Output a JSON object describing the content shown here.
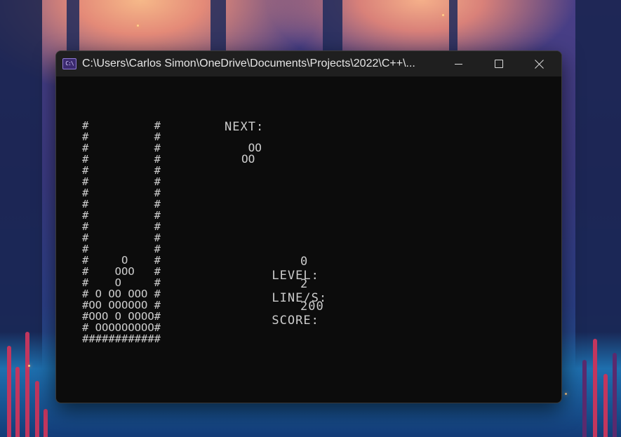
{
  "window": {
    "title": "C:\\Users\\Carlos Simon\\OneDrive\\Documents\\Projects\\2022\\C++\\...",
    "icon": "console-app-icon",
    "icon_text": "C:\\"
  },
  "controls": {
    "minimize": "minimize-icon",
    "maximize": "maximize-icon",
    "close": "close-icon"
  },
  "game": {
    "board_rows": [
      "#          #",
      "#          #",
      "#          #",
      "#          #",
      "#          #",
      "#          #",
      "#          #",
      "#          #",
      "#          #",
      "#          #",
      "#          #",
      "#          #",
      "#     O    #",
      "#    OOO   #",
      "#    O     #",
      "# O OO OOO #",
      "#OO OOOOOO #",
      "#OOO O OOOO#",
      "# OOOOOOOOO#",
      "############"
    ],
    "next_label": "NEXT:",
    "next_piece_rows": [
      " OO",
      "OO"
    ],
    "level_label": "LEVEL:",
    "level_value": "0",
    "lines_label": "LINE/S:",
    "lines_value": "2",
    "score_label": "SCORE:",
    "score_value": "200"
  },
  "colors": {
    "console_bg": "#0c0c0c",
    "console_text": "#cccccc",
    "titlebar_bg": "#1f1f1f"
  }
}
